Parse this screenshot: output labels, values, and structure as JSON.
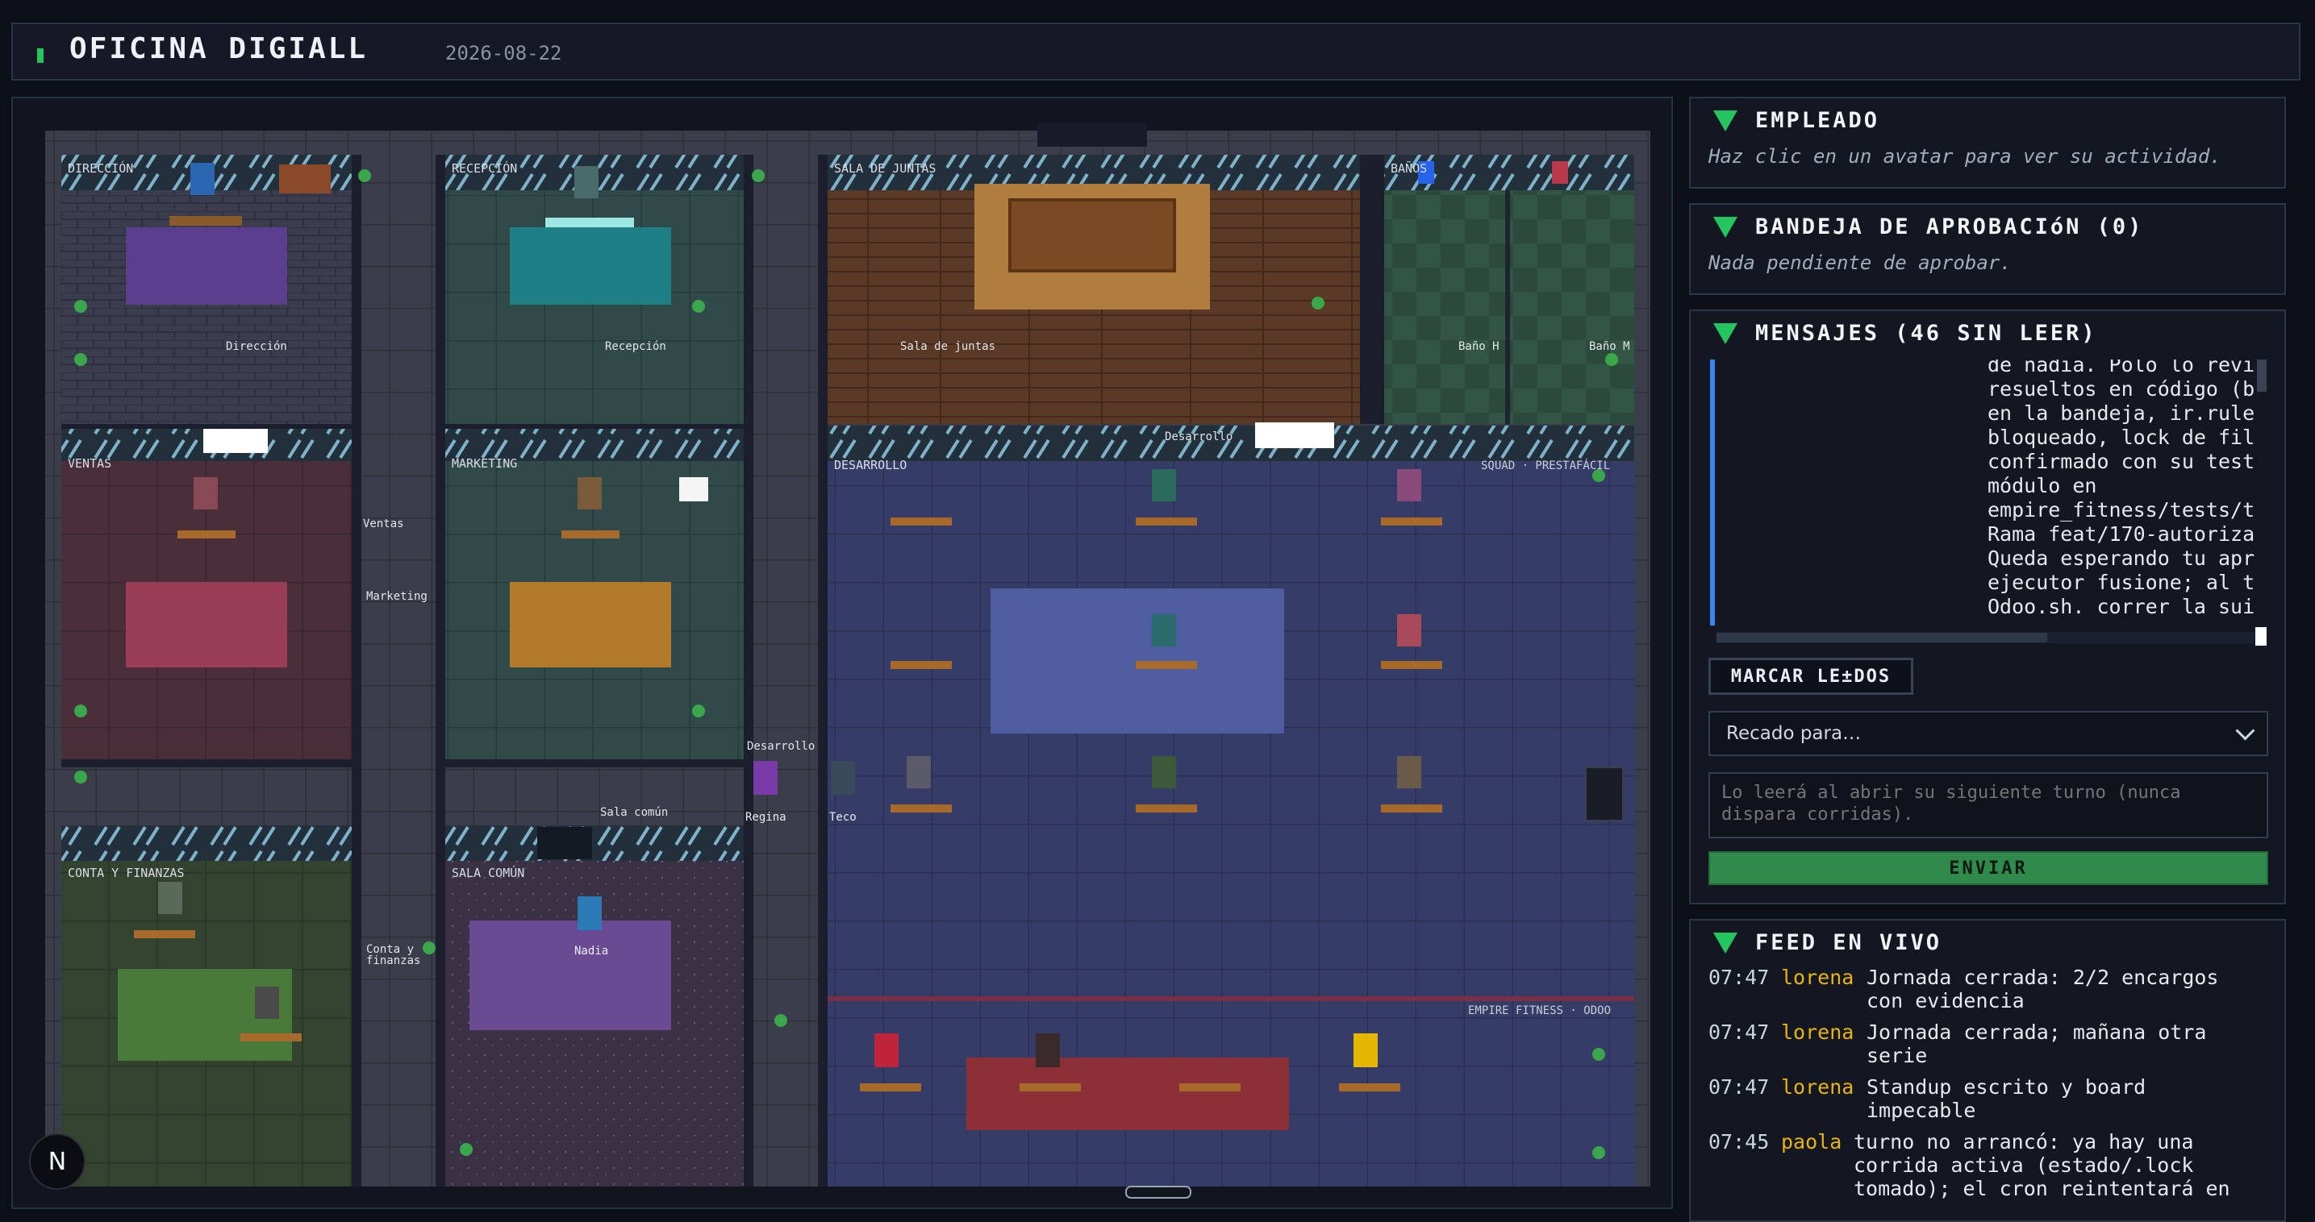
{
  "header": {
    "title": "OFICINA DIGIALL",
    "date": "2026-08-22"
  },
  "office": {
    "rooms": [
      {
        "label": "DIRECCIÓN"
      },
      {
        "label": "RECEPCIÓN"
      },
      {
        "label": "SALA DE JUNTAS"
      },
      {
        "label": "BAÑOS"
      },
      {
        "label": "VENTAS"
      },
      {
        "label": "MARKETING"
      },
      {
        "label": "DESARROLLO"
      },
      {
        "label": "CONTA Y FINANZAS"
      },
      {
        "label": "SALA COMÚN"
      }
    ],
    "signs": [
      "Dirección",
      "Recepción",
      "Sala de juntas",
      "Baño H",
      "Baño M",
      "Ventas",
      "Marketing",
      "Desarrollo",
      "Desarrollo",
      "Sala común",
      "Conta y",
      "finanzas"
    ],
    "squads": [
      "SQUAD · PRESTAFÁCIL",
      "EMPIRE FITNESS · ODOO"
    ],
    "named_avatars": [
      "Regina",
      "Teco",
      "Nadia"
    ],
    "badge": "N"
  },
  "empleado": {
    "title": "EMPLEADO",
    "hint": "Haz clic en un avatar para ver su actividad."
  },
  "bandeja": {
    "title": "BANDEJA DE APROBACIóN (0)",
    "hint": "Nada pendiente de aprobar."
  },
  "mensajes": {
    "title": "MENSAJES (46 SIN LEER)",
    "body": "de nadia. Polo lo revi\nresueltos en código (b\nen la bandeja, ir.rule\nbloqueado, lock de fil\nconfirmado con su test\nmódulo en\nempire_fitness/tests/t\nRama feat/170-autoriza\nQueda esperando tu apr\nejecutor fusione; al t\nOdoo.sh. correr la sui",
    "mark_read": "MARCAR LE±DOS",
    "recipient_placeholder": "Recado para…",
    "note_placeholder": "Lo leerá al abrir su siguiente turno (nunca dispara corridas).",
    "send": "ENVIAR"
  },
  "feed": {
    "title": "FEED EN VIVO",
    "items": [
      {
        "time": "07:47",
        "who": "lorena",
        "msg": "Jornada cerrada: 2/2 encargos\ncon evidencia"
      },
      {
        "time": "07:47",
        "who": "lorena",
        "msg": "Jornada cerrada; mañana otra\nserie"
      },
      {
        "time": "07:47",
        "who": "lorena",
        "msg": "Standup escrito y board\nimpecable"
      },
      {
        "time": "07:45",
        "who": "paola",
        "msg": "turno no arrancó: ya hay una\ncorrida activa (estado/.lock\ntomado); el cron reintentará en"
      }
    ]
  }
}
